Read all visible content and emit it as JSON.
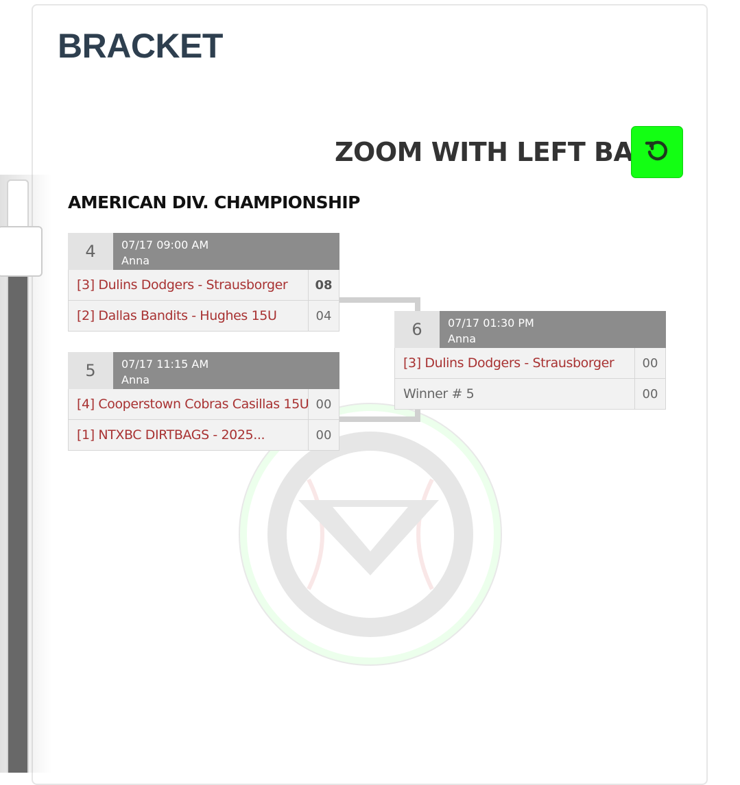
{
  "page": {
    "title": "BRACKET"
  },
  "toolbar": {
    "zoom_label": "ZOOM WITH LEFT BAR",
    "reset_icon": "reset-icon",
    "accent": "#13ff13"
  },
  "zoom_slider": {
    "level": 0.08
  },
  "bracket": {
    "title": "AMERICAN DIV. CHAMPIONSHIP",
    "games": [
      {
        "number": "4",
        "datetime": "07/17 09:00 AM",
        "field": "Anna",
        "teams": [
          {
            "name": "[3] Dulins Dodgers - Strausborger",
            "score": "08"
          },
          {
            "name": "[2] Dallas Bandits - Hughes 15U",
            "score": "04"
          }
        ]
      },
      {
        "number": "5",
        "datetime": "07/17 11:15 AM",
        "field": "Anna",
        "teams": [
          {
            "name": "[4] Cooperstown Cobras Casillas 15U",
            "score": "00"
          },
          {
            "name": "[1] NTXBC DIRTBAGS - 2025...",
            "score": "00"
          }
        ]
      },
      {
        "number": "6",
        "datetime": "07/17 01:30 PM",
        "field": "Anna",
        "teams": [
          {
            "name": "[3] Dulins Dodgers - Strausborger",
            "score": "00"
          },
          {
            "name": "Winner # 5",
            "score": "00"
          }
        ]
      }
    ]
  },
  "colors": {
    "team_link": "#a83232",
    "header_bg": "#8c8c8c",
    "title": "#2e3f4f"
  }
}
